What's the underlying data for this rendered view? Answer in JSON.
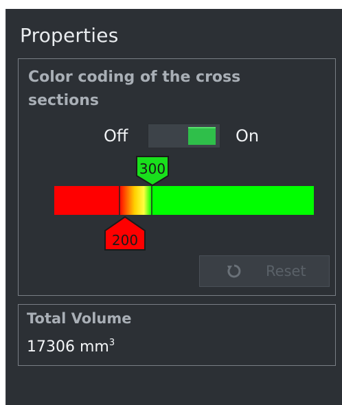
{
  "panel": {
    "title": "Properties"
  },
  "color_coding": {
    "title": "Color coding of the cross sections",
    "toggle": {
      "off_label": "Off",
      "on_label": "On",
      "state": "on"
    },
    "ramp": {
      "low_marker": "200",
      "high_marker": "300",
      "low_color": "#ff0000",
      "high_color": "#00ff00",
      "mid_color": "#ffff00"
    },
    "reset_button": {
      "label": "Reset",
      "enabled": false,
      "icon": "reset-icon"
    }
  },
  "volume": {
    "title": "Total Volume",
    "value": "17306 mm",
    "unit_exponent": "3"
  },
  "colors": {
    "panel_bg": "#2c3035",
    "accent_green": "#2fbf4a"
  }
}
